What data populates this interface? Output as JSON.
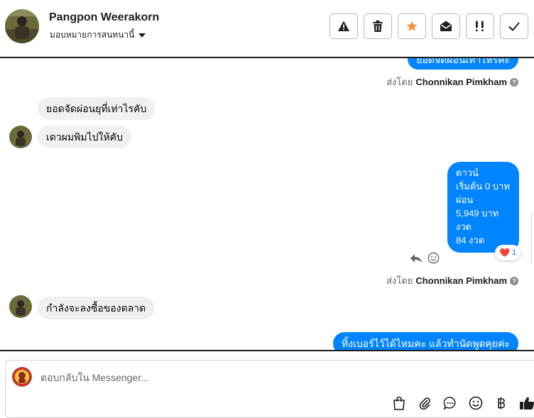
{
  "header": {
    "contact_name": "Pangpon Weerakorn",
    "assign_label": "มอบหมายการสนทนานี้",
    "toolbar": [
      {
        "name": "report-spam-button",
        "icon": "warning-icon"
      },
      {
        "name": "delete-button",
        "icon": "trash-icon"
      },
      {
        "name": "star-button",
        "icon": "star-icon",
        "color": "#f7923b"
      },
      {
        "name": "mark-unread-button",
        "icon": "envelope-open-icon"
      },
      {
        "name": "follow-up-button",
        "icon": "exclamation-icon"
      },
      {
        "name": "mark-done-button",
        "icon": "checkmark-icon"
      }
    ]
  },
  "thread": {
    "top_partial_message": "ยอดจัดผ่อนเท่าไหร่คะ",
    "sent_by_1": {
      "prefix": "ส่งโดย",
      "name": "Chonnikan Pimkham"
    },
    "msg_in_1": "ยอดจัดผ่อนยุที่เท่าไรคับ",
    "msg_in_2": "เดวผมพิมไปให้คับ",
    "msg_out_quote": [
      "ดาวน์",
      "เริ่มต้น 0 บาท",
      "ผ่อน",
      "5,949 บาท",
      "งวด",
      "84 งวด"
    ],
    "reaction": {
      "emoji": "❤️",
      "count": "1"
    },
    "sent_by_2": {
      "prefix": "ส่งโดย",
      "name": "Chonnikan Pimkham"
    },
    "msg_in_3": "กำลังจะลงซื้อของตลาด",
    "msg_out_bottom": "ทิ้งเบอร์ไว้ได้ไหมคะ แล้วทำนัดพูดคุยค่ะ"
  },
  "composer": {
    "placeholder": "ตอบกลับใน Messenger...",
    "icons": [
      "shopping-bag-icon",
      "paperclip-icon",
      "saved-reply-icon",
      "emoji-icon",
      "baht-icon",
      "thumbs-up-icon"
    ]
  },
  "colors": {
    "outgoing_bubble": "#0084ff",
    "incoming_bubble": "#f0f0f0",
    "star": "#f7923b"
  }
}
